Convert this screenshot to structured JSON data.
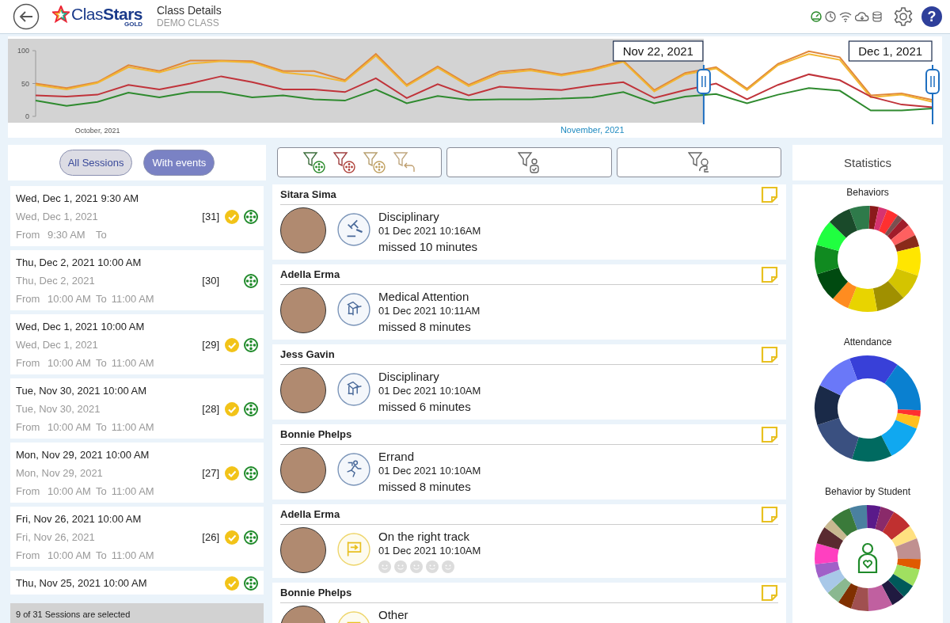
{
  "header": {
    "logo": "Clas**Stars**",
    "logo_badge": "GOLD",
    "title": "Class Details",
    "subtitle": "DEMO CLASS",
    "help": "?"
  },
  "timeline": {
    "chart_data": {
      "type": "line",
      "categories": [
        null,
        null,
        "October, 2021",
        null,
        null,
        null,
        null,
        null,
        null,
        null,
        null,
        null,
        null,
        null,
        null,
        null,
        null,
        null,
        "November, 2021",
        null,
        null,
        null,
        null,
        null,
        null,
        null,
        null,
        null,
        null,
        null
      ],
      "series": [
        {
          "color": "#e0873a",
          "values": [
            50,
            43,
            52,
            78,
            69,
            85,
            85,
            84,
            69,
            69,
            55,
            95,
            48,
            76,
            48,
            68,
            72,
            64,
            72,
            85,
            40,
            66,
            75,
            42,
            80,
            99,
            90,
            32,
            35,
            25
          ]
        },
        {
          "color": "#f2b632",
          "values": [
            48,
            41,
            51,
            75,
            67,
            80,
            84,
            82,
            67,
            62,
            53,
            92,
            46,
            74,
            46,
            65,
            70,
            62,
            70,
            83,
            38,
            64,
            73,
            40,
            78,
            95,
            86,
            29,
            33,
            22
          ]
        },
        {
          "color": "#c0333a",
          "values": [
            32,
            30,
            33,
            48,
            41,
            50,
            61,
            52,
            41,
            41,
            37,
            58,
            28,
            49,
            32,
            45,
            42,
            40,
            47,
            52,
            28,
            40,
            50,
            26,
            48,
            64,
            55,
            30,
            18,
            14
          ]
        },
        {
          "color": "#2e8a2e",
          "values": [
            24,
            16,
            22,
            36,
            29,
            37,
            37,
            29,
            32,
            26,
            24,
            41,
            20,
            31,
            25,
            26,
            26,
            27,
            29,
            37,
            20,
            30,
            34,
            20,
            33,
            43,
            39,
            9,
            9,
            12
          ]
        }
      ],
      "ylim": [
        0,
        100
      ],
      "yticks": [
        0,
        50,
        100
      ],
      "annotations": [
        "Nov 22, 2021",
        "Dec 1, 2021"
      ]
    }
  },
  "session_tabs": [
    {
      "label": "All Sessions",
      "selected": false
    },
    {
      "label": "With events",
      "selected": true
    }
  ],
  "sessions": [
    {
      "title": "Wed, Dec 1, 2021 9:30 AM",
      "date": "Wed, Dec 1, 2021",
      "from_label": "From",
      "from": "9:30 AM",
      "to_label": "To",
      "count": "[31]",
      "checked": true
    },
    {
      "title": "Thu, Dec 2, 2021 10:00 AM",
      "date": "Thu, Dec 2, 2021",
      "from_label": "From",
      "from": "10:00 AM",
      "to_label": "To",
      "to": "11:00 AM",
      "count": "[30]",
      "checked": false
    },
    {
      "title": "Wed, Dec 1, 2021 10:00 AM",
      "date": "Wed, Dec 1, 2021",
      "from_label": "From",
      "from": "10:00 AM",
      "to_label": "To",
      "to": "11:00 AM",
      "count": "[29]",
      "checked": true
    },
    {
      "title": "Tue, Nov 30, 2021 10:00 AM",
      "date": "Tue, Nov 30, 2021",
      "from_label": "From",
      "from": "10:00 AM",
      "to_label": "To",
      "to": "11:00 AM",
      "count": "[28]",
      "checked": true
    },
    {
      "title": "Mon, Nov 29, 2021 10:00 AM",
      "date": "Mon, Nov 29, 2021",
      "from_label": "From",
      "from": "10:00 AM",
      "to_label": "To",
      "to": "11:00 AM",
      "count": "[27]",
      "checked": true
    },
    {
      "title": "Fri, Nov 26, 2021 10:00 AM",
      "date": "Fri, Nov 26, 2021",
      "from_label": "From",
      "from": "10:00 AM",
      "to_label": "To",
      "to": "11:00 AM",
      "count": "[26]",
      "checked": true
    },
    {
      "title": "Thu, Nov 25, 2021 10:00 AM",
      "checked": true
    }
  ],
  "sessions_footer": "9 of 31 Sessions are selected",
  "events": [
    {
      "student": "Sitara Sima",
      "kind": "gavel",
      "title": "Disciplinary",
      "time": "01 Dec 2021 10:16AM",
      "detail": "missed 10 minutes"
    },
    {
      "student": "Adella Erma",
      "kind": "desk",
      "title": "Medical Attention",
      "time": "01 Dec 2021 10:11AM",
      "detail": "missed 8 minutes"
    },
    {
      "student": "Jess Gavin",
      "kind": "desk",
      "title": "Disciplinary",
      "time": "01 Dec 2021 10:10AM",
      "detail": "missed 6 minutes"
    },
    {
      "student": "Bonnie Phelps",
      "kind": "runner",
      "title": "Errand",
      "time": "01 Dec 2021 10:10AM",
      "detail": "missed 8 minutes"
    },
    {
      "student": "Adella Erma",
      "kind": "flag",
      "title": "On the right track",
      "time": "01 Dec 2021 10:10AM",
      "stars": 0
    },
    {
      "student": "Bonnie Phelps",
      "kind": "list",
      "title": "Other"
    }
  ],
  "statistics": {
    "title": "Statistics",
    "charts": [
      {
        "title": "Behaviors",
        "kind": "behaviors"
      },
      {
        "title": "Attendance",
        "kind": "attendance"
      },
      {
        "title": "Behavior by Student",
        "kind": "students"
      }
    ]
  }
}
